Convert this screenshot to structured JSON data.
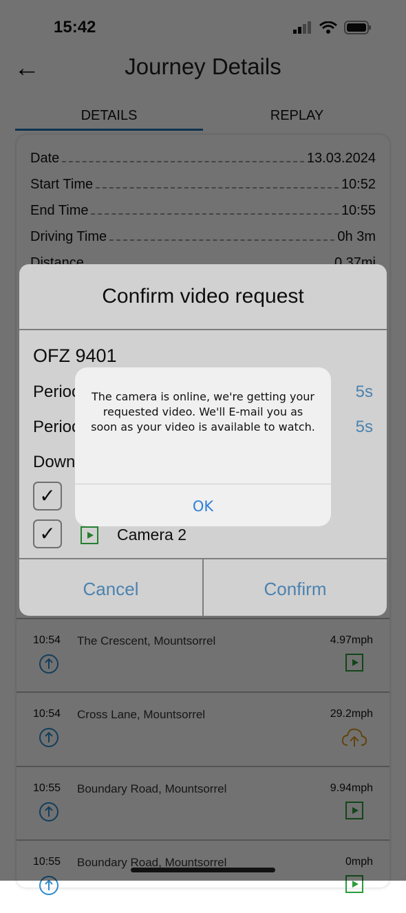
{
  "status": {
    "time": "15:42"
  },
  "header": {
    "title": "Journey Details",
    "back_icon": "arrow-left-icon"
  },
  "tabs": [
    {
      "label": "DETAILS",
      "active": true
    },
    {
      "label": "REPLAY",
      "active": false
    }
  ],
  "details": [
    {
      "label": "Date",
      "value": "13.03.2024"
    },
    {
      "label": "Start Time",
      "value": "10:52"
    },
    {
      "label": "End Time",
      "value": "10:55"
    },
    {
      "label": "Driving Time",
      "value": "0h 3m"
    },
    {
      "label": "Distance",
      "value": "0.37mi"
    }
  ],
  "events": [
    {
      "time": "10:54",
      "location": "The Crescent, Mountsorrel",
      "speed": "4.97mph",
      "action": "play-video-icon"
    },
    {
      "time": "10:54",
      "location": "Cross Lane, Mountsorrel",
      "speed": "29.2mph",
      "action": "cloud-upload-icon"
    },
    {
      "time": "10:55",
      "location": "Boundary Road, Mountsorrel",
      "speed": "9.94mph",
      "action": "play-video-icon"
    },
    {
      "time": "10:55",
      "location": "Boundary Road, Mountsorrel",
      "speed": "0mph",
      "action": "play-video-icon"
    }
  ],
  "modal": {
    "title": "Confirm video request",
    "plate": "OFZ 9401",
    "period_before_label": "Perioc",
    "period_before_value": "5s",
    "period_after_label": "Perioc",
    "period_after_value": "5s",
    "download_label": "Down",
    "camera2_label": "Camera 2",
    "cancel": "Cancel",
    "confirm": "Confirm"
  },
  "alert": {
    "message": "The camera is online, we're getting your requested video. We'll E-mail you as soon as your video is available to watch.",
    "ok": "OK"
  },
  "colors": {
    "accent": "#2f7fd8",
    "link": "#5c9fd6",
    "play": "#2a9b3a",
    "upload": "#d99a1c"
  }
}
